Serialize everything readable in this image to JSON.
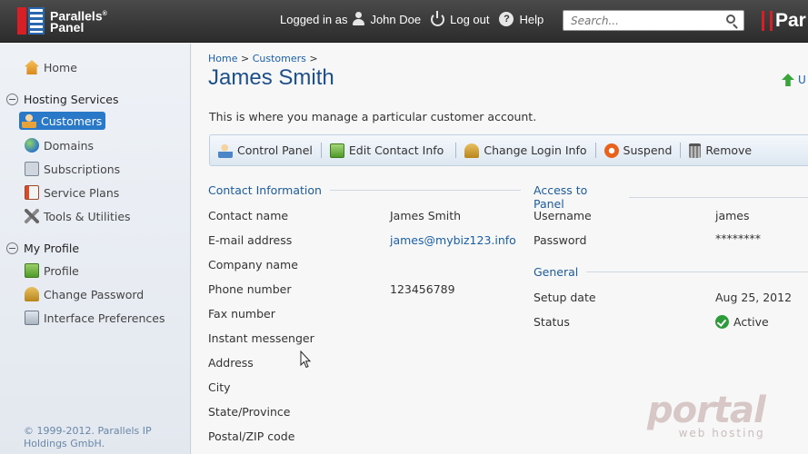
{
  "header": {
    "logo_line1": "Parallels",
    "logo_line2": "Panel",
    "logged_in_as": "Logged in as",
    "user_name": "John Doe",
    "logout": "Log out",
    "help": "Help",
    "search_placeholder": "Search...",
    "brand_right": "Par"
  },
  "sidebar": {
    "home": "Home",
    "hosting_services": "Hosting Services",
    "customers": "Customers",
    "domains": "Domains",
    "subscriptions": "Subscriptions",
    "service_plans": "Service Plans",
    "tools_utilities": "Tools & Utilities",
    "my_profile": "My Profile",
    "profile": "Profile",
    "change_password": "Change Password",
    "interface_preferences": "Interface Preferences",
    "copyright": "© 1999-2012. Parallels IP Holdings GmbH."
  },
  "main": {
    "breadcrumb_home": "Home",
    "breadcrumb_customers": "Customers",
    "breadcrumb_sep": ">",
    "title": "James Smith",
    "up_link": "U",
    "description": "This is where you manage a particular customer account.",
    "toolbar": {
      "control_panel": "Control Panel",
      "edit_contact_info": "Edit Contact Info",
      "change_login_info": "Change Login Info",
      "suspend": "Suspend",
      "remove": "Remove"
    },
    "contact": {
      "heading": "Contact Information",
      "fields": [
        {
          "label": "Contact name",
          "value": "James Smith"
        },
        {
          "label": "E-mail address",
          "value": "james@mybiz123.info"
        },
        {
          "label": "Company name",
          "value": ""
        },
        {
          "label": "Phone number",
          "value": "123456789"
        },
        {
          "label": "Fax number",
          "value": ""
        },
        {
          "label": "Instant messenger",
          "value": ""
        },
        {
          "label": "Address",
          "value": ""
        },
        {
          "label": "City",
          "value": ""
        },
        {
          "label": "State/Province",
          "value": ""
        },
        {
          "label": "Postal/ZIP code",
          "value": ""
        }
      ]
    },
    "access": {
      "heading": "Access to Panel",
      "username_label": "Username",
      "username_value": "james",
      "password_label": "Password",
      "password_value": "********"
    },
    "general": {
      "heading": "General",
      "setup_label": "Setup date",
      "setup_value": "Aug 25, 2012",
      "status_label": "Status",
      "status_value": "Active"
    }
  },
  "watermark": {
    "line1": "portal",
    "line2": "web hosting"
  },
  "colors": {
    "accent": "#2a78c8",
    "heading": "#1d5b9a",
    "status_ok": "#2e9b3a"
  }
}
